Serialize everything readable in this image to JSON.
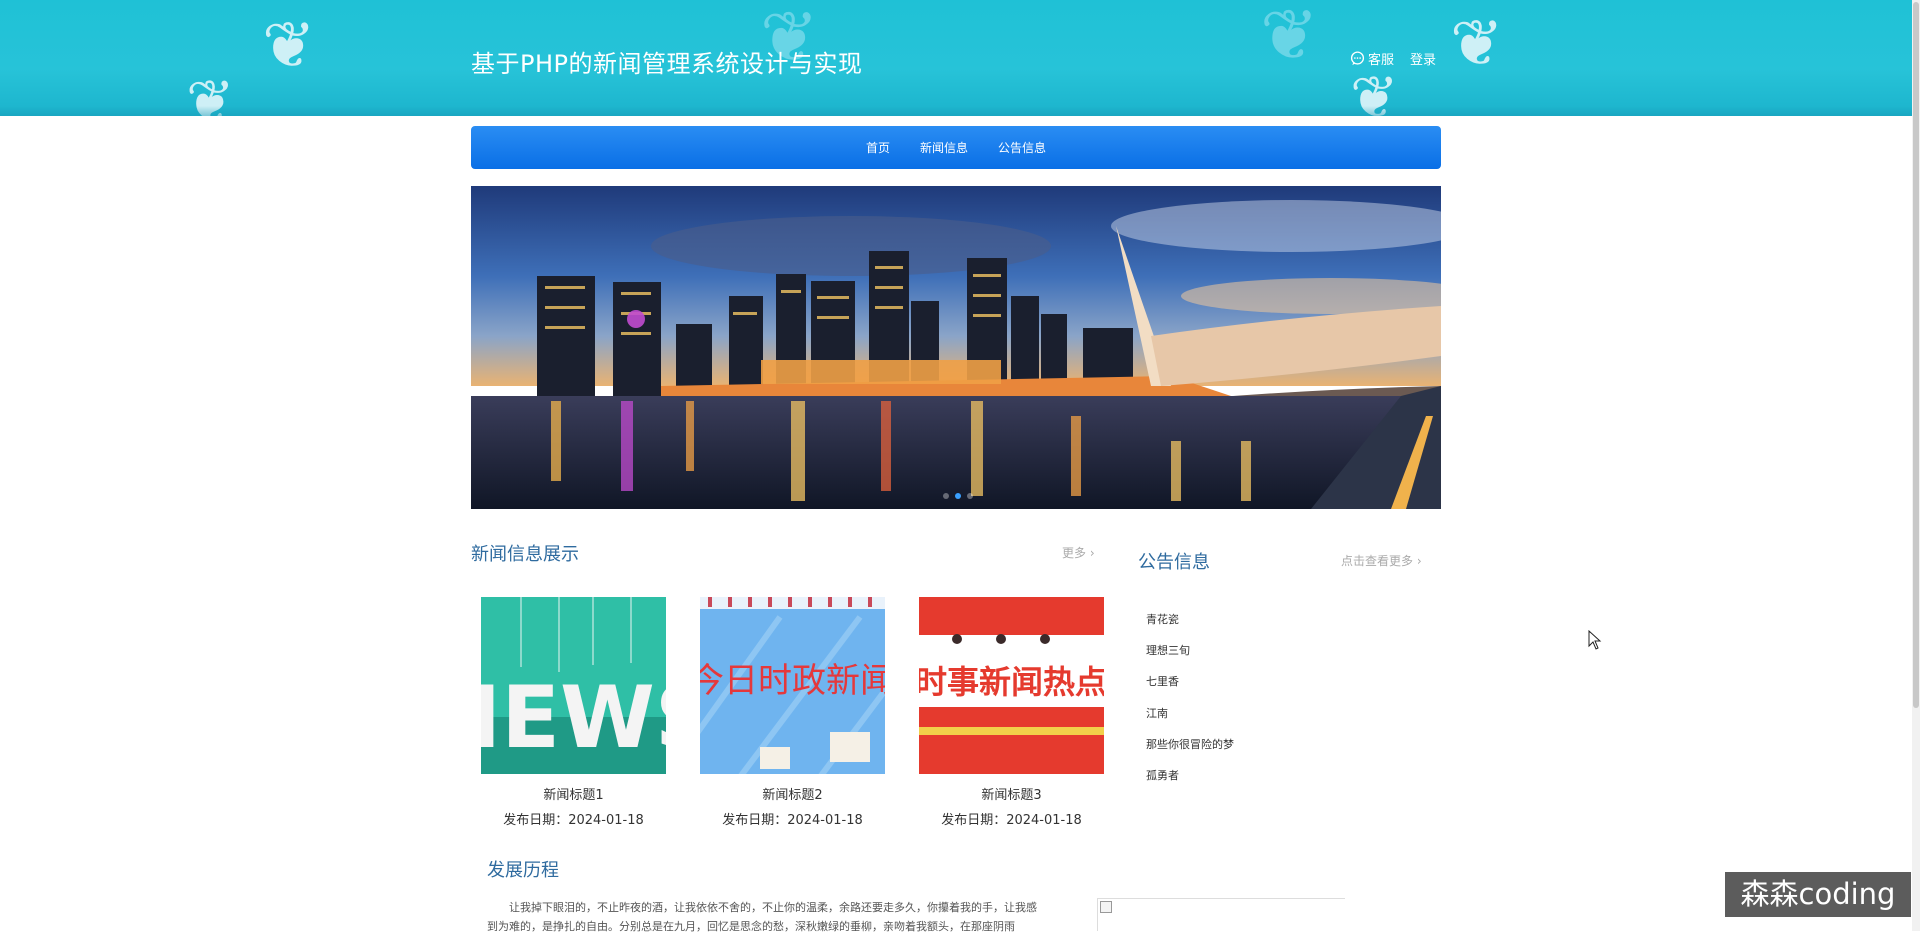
{
  "header": {
    "title": "基于PHP的新闻管理系统设计与实现",
    "service_label": "客服",
    "login_label": "登录"
  },
  "nav": {
    "items": [
      {
        "label": "首页"
      },
      {
        "label": "新闻信息"
      },
      {
        "label": "公告信息"
      }
    ]
  },
  "banner": {
    "slides": 3,
    "active_slide": 2
  },
  "news": {
    "section_title": "新闻信息展示",
    "more_label": "更多 ›",
    "cards": [
      {
        "title": "新闻标题1",
        "date_prefix": "发布日期：",
        "date": "2024-01-18",
        "thumb_text": "NEWS"
      },
      {
        "title": "新闻标题2",
        "date_prefix": "发布日期：",
        "date": "2024-01-18",
        "thumb_text": "今日时政新闻"
      },
      {
        "title": "新闻标题3",
        "date_prefix": "发布日期：",
        "date": "2024-01-18",
        "thumb_text": "时事新闻热点"
      }
    ]
  },
  "notices": {
    "section_title": "公告信息",
    "more_label": "点击查看更多 ›",
    "items": [
      "青花瓷",
      "理想三旬",
      "七里香",
      "江南",
      "那些你很冒险的梦",
      "孤勇者"
    ]
  },
  "history": {
    "section_title": "发展历程",
    "text": "让我掉下眼泪的，不止昨夜的酒，让我依依不舍的，不止你的温柔，余路还要走多久，你攥着我的手，让我感到为难的，是挣扎的自由。分别总是在九月，回忆是思念的愁，深秋嫩绿的垂柳，亲吻着我额头，在那座阴雨"
  },
  "watermark": "森森coding",
  "colors": {
    "header_bg": "#27c3d8",
    "nav_bg": "#0a6fe6",
    "section_title": "#2f6b9f"
  }
}
